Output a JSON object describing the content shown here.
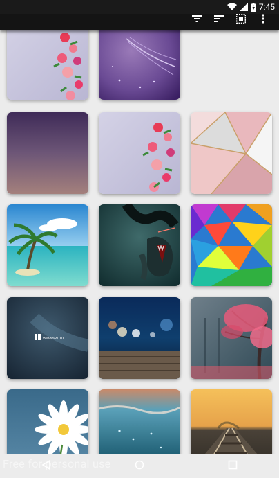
{
  "status": {
    "time": "7:45"
  },
  "toolbar": {
    "icons": [
      "filter-icon",
      "sort-icon",
      "select-all-icon",
      "overflow-menu-icon"
    ]
  },
  "wallpapers": [
    {
      "name": "flowers-on-lavender-1"
    },
    {
      "name": "purple-feather"
    },
    {
      "name": "purple-gradient"
    },
    {
      "name": "flowers-on-lavender-2"
    },
    {
      "name": "pink-marble-geometric"
    },
    {
      "name": "palm-tree-beach"
    },
    {
      "name": "dark-sea-monster"
    },
    {
      "name": "rainbow-polygons"
    },
    {
      "name": "windows-10-dark"
    },
    {
      "name": "bokeh-wood-deck"
    },
    {
      "name": "pink-tree-fog"
    },
    {
      "name": "white-daisy"
    },
    {
      "name": "underwater-sunset"
    },
    {
      "name": "railroad-sunset"
    }
  ],
  "tile_texts": {
    "windows": "Windows 10"
  },
  "nav": {
    "buttons": [
      "back-icon",
      "home-icon",
      "recents-icon"
    ]
  },
  "watermark": {
    "text": "Free for personal use"
  }
}
